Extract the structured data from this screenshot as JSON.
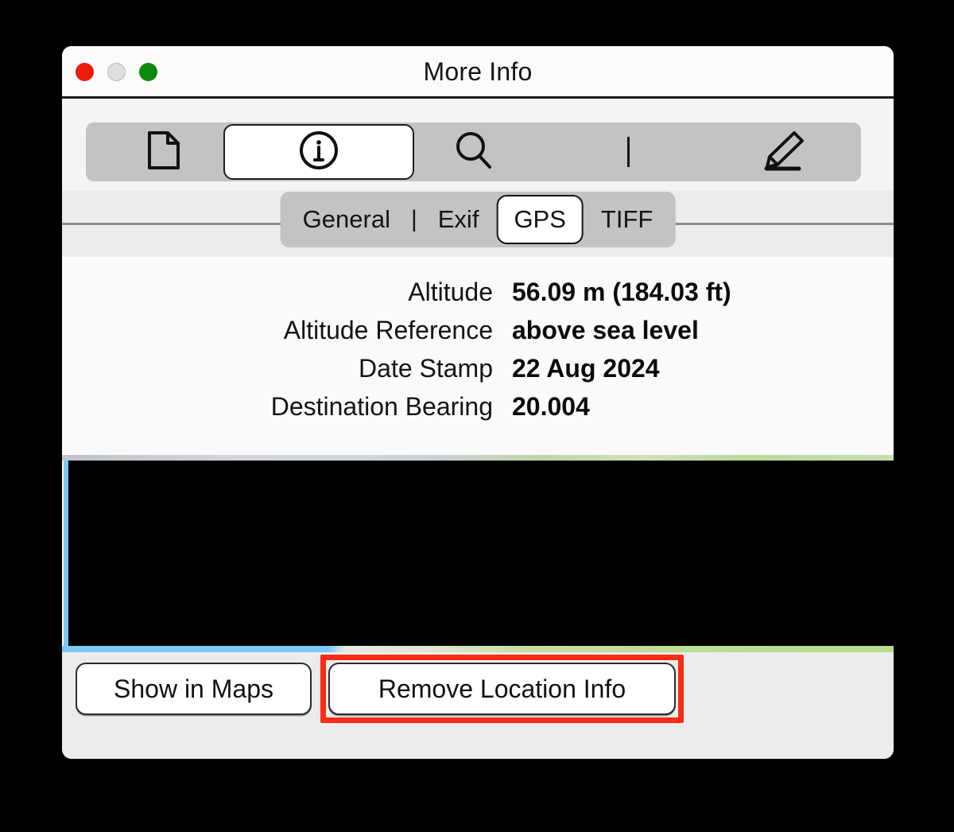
{
  "window": {
    "title": "More Info",
    "traffic_lights": [
      {
        "name": "close",
        "color": "#ec1a0d"
      },
      {
        "name": "minimize",
        "color": "#dedede"
      },
      {
        "name": "zoom",
        "color": "#0d8a0d"
      }
    ]
  },
  "toolbar": {
    "items": [
      {
        "icon": "document-icon",
        "selected": false
      },
      {
        "icon": "info-icon",
        "selected": true
      },
      {
        "icon": "search-icon",
        "selected": false
      },
      {
        "icon": "divider",
        "selected": false
      },
      {
        "icon": "pencil-markup-icon",
        "selected": false
      }
    ]
  },
  "tabs": {
    "items": [
      {
        "label": "General",
        "selected": false
      },
      {
        "label": "Exif",
        "selected": false
      },
      {
        "label": "GPS",
        "selected": true
      },
      {
        "label": "TIFF",
        "selected": false
      }
    ],
    "separator": "|"
  },
  "metadata": {
    "rows": [
      {
        "label": "Altitude",
        "value": "56.09 m (184.03 ft)"
      },
      {
        "label": "Altitude Reference",
        "value": "above sea level"
      },
      {
        "label": "Date Stamp",
        "value": "22 Aug 2024"
      },
      {
        "label": "Destination Bearing",
        "value": "20.004"
      }
    ]
  },
  "map": {
    "state": "redacted"
  },
  "footer": {
    "show_in_maps_label": "Show in Maps",
    "remove_location_label": "Remove Location Info",
    "highlight_color": "#fc2b16",
    "highlight_target": "remove-location-info-button"
  }
}
